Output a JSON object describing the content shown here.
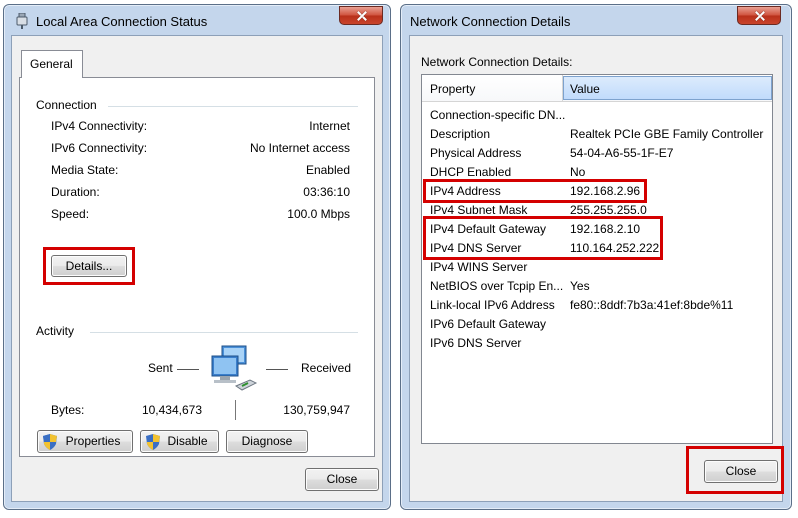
{
  "status_window": {
    "title": "Local Area Connection Status",
    "tab": "General",
    "connection": {
      "heading": "Connection",
      "rows": [
        {
          "label": "IPv4 Connectivity:",
          "value": "Internet"
        },
        {
          "label": "IPv6 Connectivity:",
          "value": "No Internet access"
        },
        {
          "label": "Media State:",
          "value": "Enabled"
        },
        {
          "label": "Duration:",
          "value": "03:36:10"
        },
        {
          "label": "Speed:",
          "value": "100.0 Mbps"
        }
      ],
      "details_button": "Details..."
    },
    "activity": {
      "heading": "Activity",
      "sent_label": "Sent",
      "received_label": "Received",
      "bytes_label": "Bytes:",
      "bytes_sent": "10,434,673",
      "bytes_received": "130,759,947"
    },
    "buttons": {
      "properties": "Properties",
      "disable": "Disable",
      "diagnose": "Diagnose",
      "close": "Close"
    }
  },
  "details_window": {
    "title": "Network Connection Details",
    "caption": "Network Connection Details:",
    "columns": {
      "property": "Property",
      "value": "Value"
    },
    "rows": [
      {
        "property": "Connection-specific DN...",
        "value": ""
      },
      {
        "property": "Description",
        "value": "Realtek PCIe GBE Family Controller"
      },
      {
        "property": "Physical Address",
        "value": "54-04-A6-55-1F-E7"
      },
      {
        "property": "DHCP Enabled",
        "value": "No"
      },
      {
        "property": "IPv4 Address",
        "value": "192.168.2.96"
      },
      {
        "property": "IPv4 Subnet Mask",
        "value": "255.255.255.0"
      },
      {
        "property": "IPv4 Default Gateway",
        "value": "192.168.2.10"
      },
      {
        "property": "IPv4 DNS Server",
        "value": "110.164.252.222"
      },
      {
        "property": "IPv4 WINS Server",
        "value": ""
      },
      {
        "property": "NetBIOS over Tcpip En...",
        "value": "Yes"
      },
      {
        "property": "Link-local IPv6 Address",
        "value": "fe80::8ddf:7b3a:41ef:8bde%11"
      },
      {
        "property": "IPv6 Default Gateway",
        "value": ""
      },
      {
        "property": "IPv6 DNS Server",
        "value": ""
      }
    ],
    "close": "Close"
  },
  "colors": {
    "highlight": "#d40000",
    "frame": "#c4d6ec"
  },
  "icons": [
    "network-adapter-icon",
    "computers-network-icon",
    "shield-icon",
    "close-icon"
  ]
}
